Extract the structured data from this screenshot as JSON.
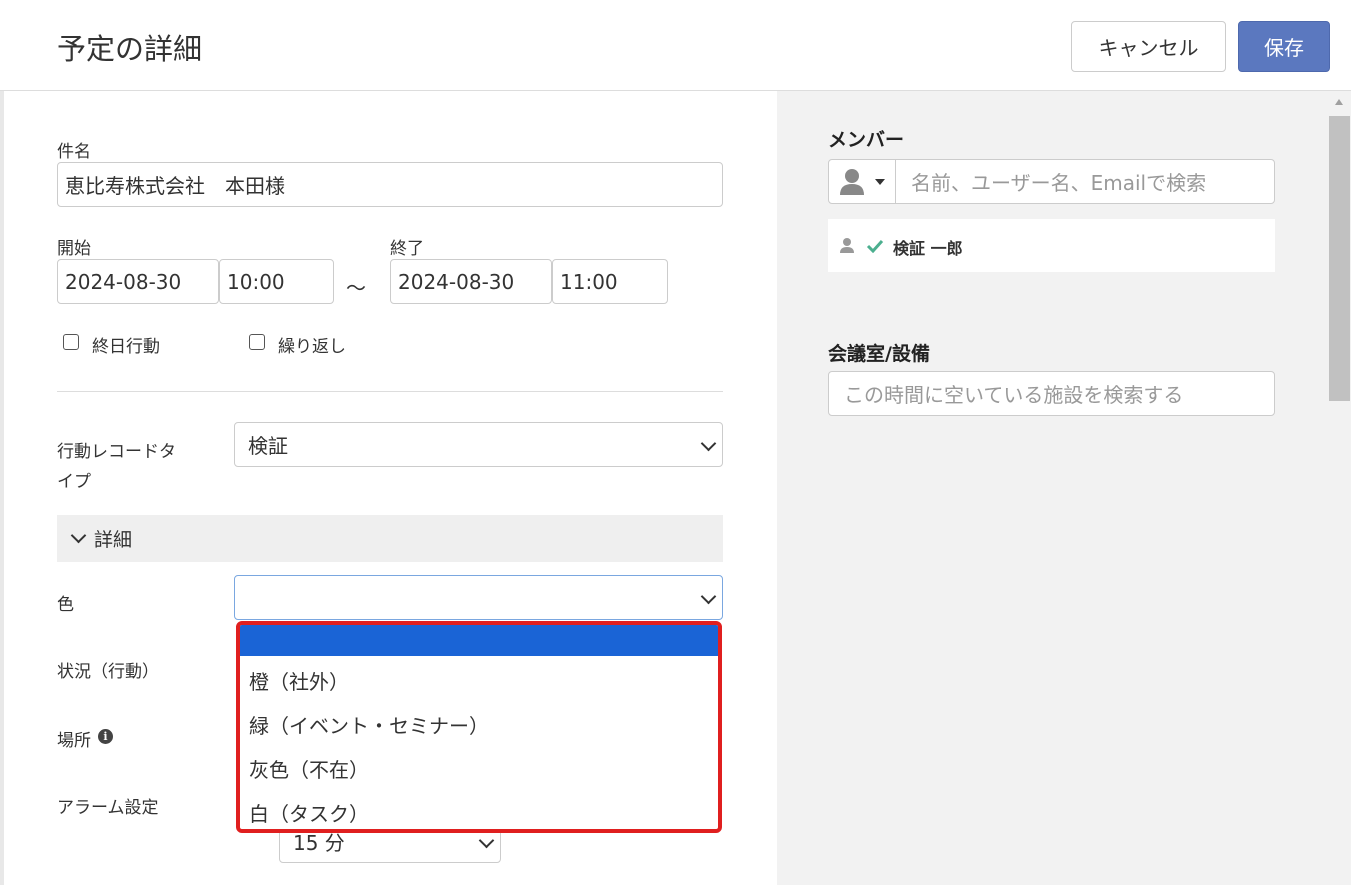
{
  "header": {
    "title": "予定の詳細",
    "cancel_label": "キャンセル",
    "save_label": "保存"
  },
  "form": {
    "subject_label": "件名",
    "subject_value": "恵比寿株式会社　本田様",
    "start_label": "開始",
    "start_date": "2024-08-30",
    "start_time": "10:00",
    "range_sep": "～",
    "end_label": "終了",
    "end_date": "2024-08-30",
    "end_time": "11:00",
    "allday_label": "終日行動",
    "repeat_label": "繰り返し",
    "record_type_label_line1": "行動レコードタ",
    "record_type_label_line2": "イプ",
    "record_type_value": "検証",
    "details_label": "詳細",
    "color_label": "色",
    "color_value": "",
    "status_label": "状況（行動）",
    "location_label": "場所",
    "alarm_label": "アラーム設定",
    "alarm_value": "15 分"
  },
  "color_options": [
    "",
    "橙（社外）",
    "緑（イベント・セミナー）",
    "灰色（不在）",
    "白（タスク）"
  ],
  "members": {
    "heading": "メンバー",
    "search_placeholder": "名前、ユーザー名、Emailで検索",
    "list": [
      {
        "name": "検証 一郎"
      }
    ]
  },
  "facilities": {
    "heading": "会議室/設備",
    "search_placeholder": "この時間に空いている施設を検索する"
  },
  "colors": {
    "accent": "#5b78bf",
    "highlight": "#1a64d6",
    "check": "#4caf8f",
    "dropdown_border": "#e01f1f"
  }
}
